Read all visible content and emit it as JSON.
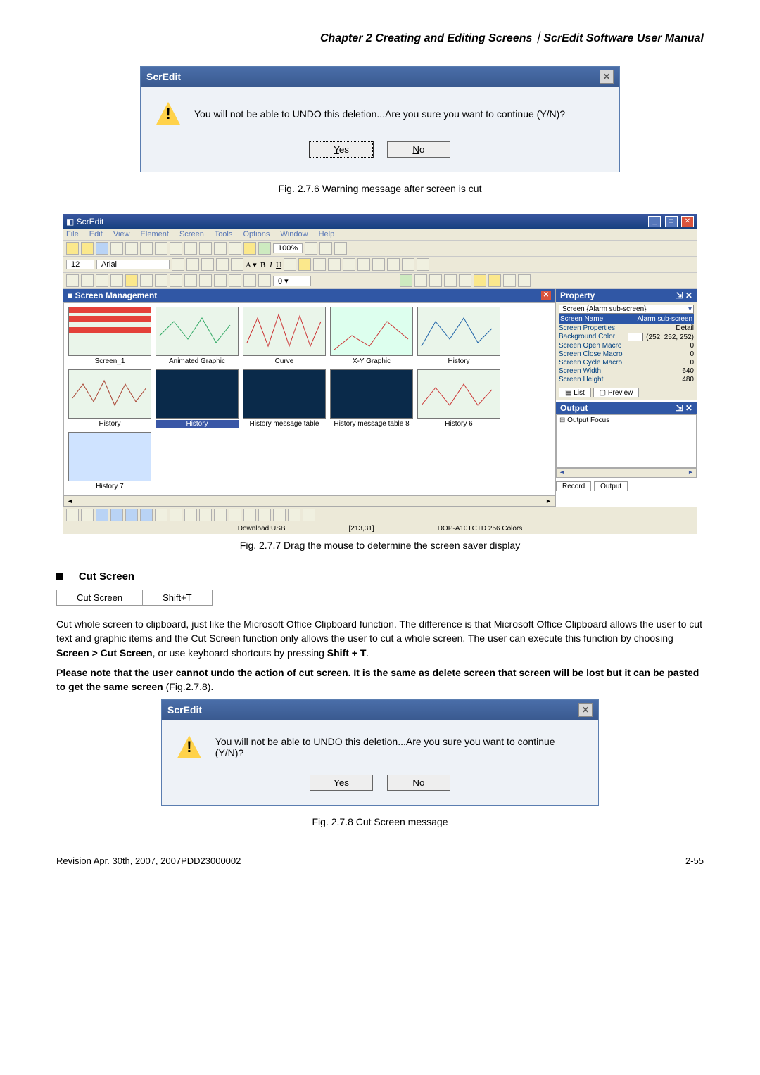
{
  "chapterHeader": "Chapter 2  Creating and Editing Screens｜ScrEdit Software User Manual",
  "dialog1": {
    "title": "ScrEdit",
    "msg": "You will not be able to UNDO this deletion...Are you sure you want to continue (Y/N)?",
    "yes": "Yes",
    "no": "No"
  },
  "caption1": "Fig. 2.7.6 Warning message after screen is cut",
  "app": {
    "title": "ScrEdit",
    "menus": [
      "File",
      "Edit",
      "View",
      "Element",
      "Screen",
      "Tools",
      "Options",
      "Window",
      "Help"
    ],
    "zoom": "100%",
    "fontList": "Arial",
    "fontSize": "12",
    "smTitle": "Screen Management",
    "thumbs": [
      "Screen_1",
      "Animated Graphic",
      "Curve",
      "X-Y Graphic",
      "History",
      "History",
      "History",
      "History message table",
      "History message table 8",
      "History 6",
      "History 7"
    ],
    "propTitle": "Property",
    "props": {
      "screenDropdown": "Screen {Alarm sub-screen}",
      "screenNameK": "Screen Name",
      "screenNameV": "Alarm sub-screen",
      "screenPropK": "Screen Properties",
      "screenPropV": "Detail",
      "bgK": "Background Color",
      "bgV": "(252, 252, 252)",
      "openK": "Screen Open Macro",
      "openV": "0",
      "closeK": "Screen Close Macro",
      "closeV": "0",
      "cycleK": "Screen Cycle Macro",
      "cycleV": "0",
      "widthK": "Screen Width",
      "widthV": "640",
      "heightK": "Screen Height",
      "heightV": "480"
    },
    "tabList": "List",
    "tabPreview": "Preview",
    "outTitle": "Output",
    "outFocus": "Output Focus",
    "recTabRecord": "Record",
    "recTabOutput": "Output",
    "status": {
      "download": "Download:USB",
      "coord": "[213,31]",
      "model": "DOP-A10TCTD 256 Colors"
    }
  },
  "caption2": "Fig. 2.7.7 Drag the mouse to determine the screen saver display",
  "sectionTitle": "Cut Screen",
  "shortcut": {
    "name": "Cut Screen",
    "keys": "Shift+T"
  },
  "para1a": "Cut whole screen to clipboard, just like the Microsoft Office Clipboard function. The difference is that Microsoft Office Clipboard allows the user to cut text and graphic items and the Cut Screen function only allows the user to cut a whole screen. The user can execute this function by choosing ",
  "para1b": "Screen > Cut Screen",
  "para1c": ", or use keyboard shortcuts by pressing ",
  "para1d": "Shift + T",
  "para1e": ".",
  "para2a": "Please note that the user cannot undo the action of cut screen. It is the same as delete screen that screen will be lost but it can be pasted to get the same screen ",
  "para2b": "(Fig.2.7.8).",
  "dialog2": {
    "title": "ScrEdit",
    "msg": "You will not be able to UNDO this deletion...Are you sure you want to continue (Y/N)?",
    "yes": "Yes",
    "no": "No"
  },
  "caption3": "Fig. 2.7.8 Cut Screen message",
  "footerLeft": "Revision Apr. 30th, 2007, 2007PDD23000002",
  "footerRight": "2-55"
}
